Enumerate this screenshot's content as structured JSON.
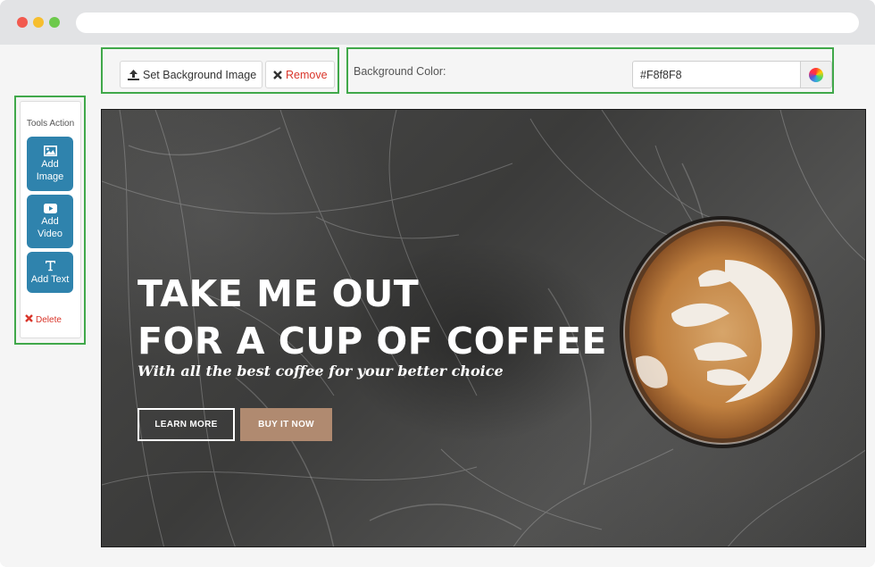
{
  "window": {
    "controls": [
      "close",
      "minimize",
      "maximize"
    ]
  },
  "toolbar": {
    "set_background_label": "Set Background Image",
    "set_background_icon": "upload-icon",
    "remove_label": "Remove",
    "remove_icon": "close-icon",
    "background_color_label": "Background Color:",
    "background_color_value": "#F8f8F8",
    "color_picker_icon": "color-wheel-icon"
  },
  "sidebar": {
    "title": "Tools Action",
    "buttons": [
      {
        "label_line1": "Add",
        "label_line2": "Image",
        "icon": "image-icon"
      },
      {
        "label_line1": "Add",
        "label_line2": "Video",
        "icon": "play-icon"
      },
      {
        "label_line1": "Add Text",
        "label_line2": "",
        "icon": "text-icon"
      }
    ],
    "delete_label": "Delete",
    "delete_icon": "close-icon"
  },
  "canvas": {
    "headline_line1": "TAKE ME OUT",
    "headline_line2": "FOR A CUP OF COFFEE",
    "subline": "With all the best coffee for your better choice",
    "learn_more_label": "LEARN MORE",
    "buy_now_label": "BUY IT NOW"
  },
  "colors": {
    "accent_button": "#2f83ad",
    "highlight_border": "#40a84a",
    "danger": "#d9352a",
    "buy_button": "#b08a70"
  }
}
